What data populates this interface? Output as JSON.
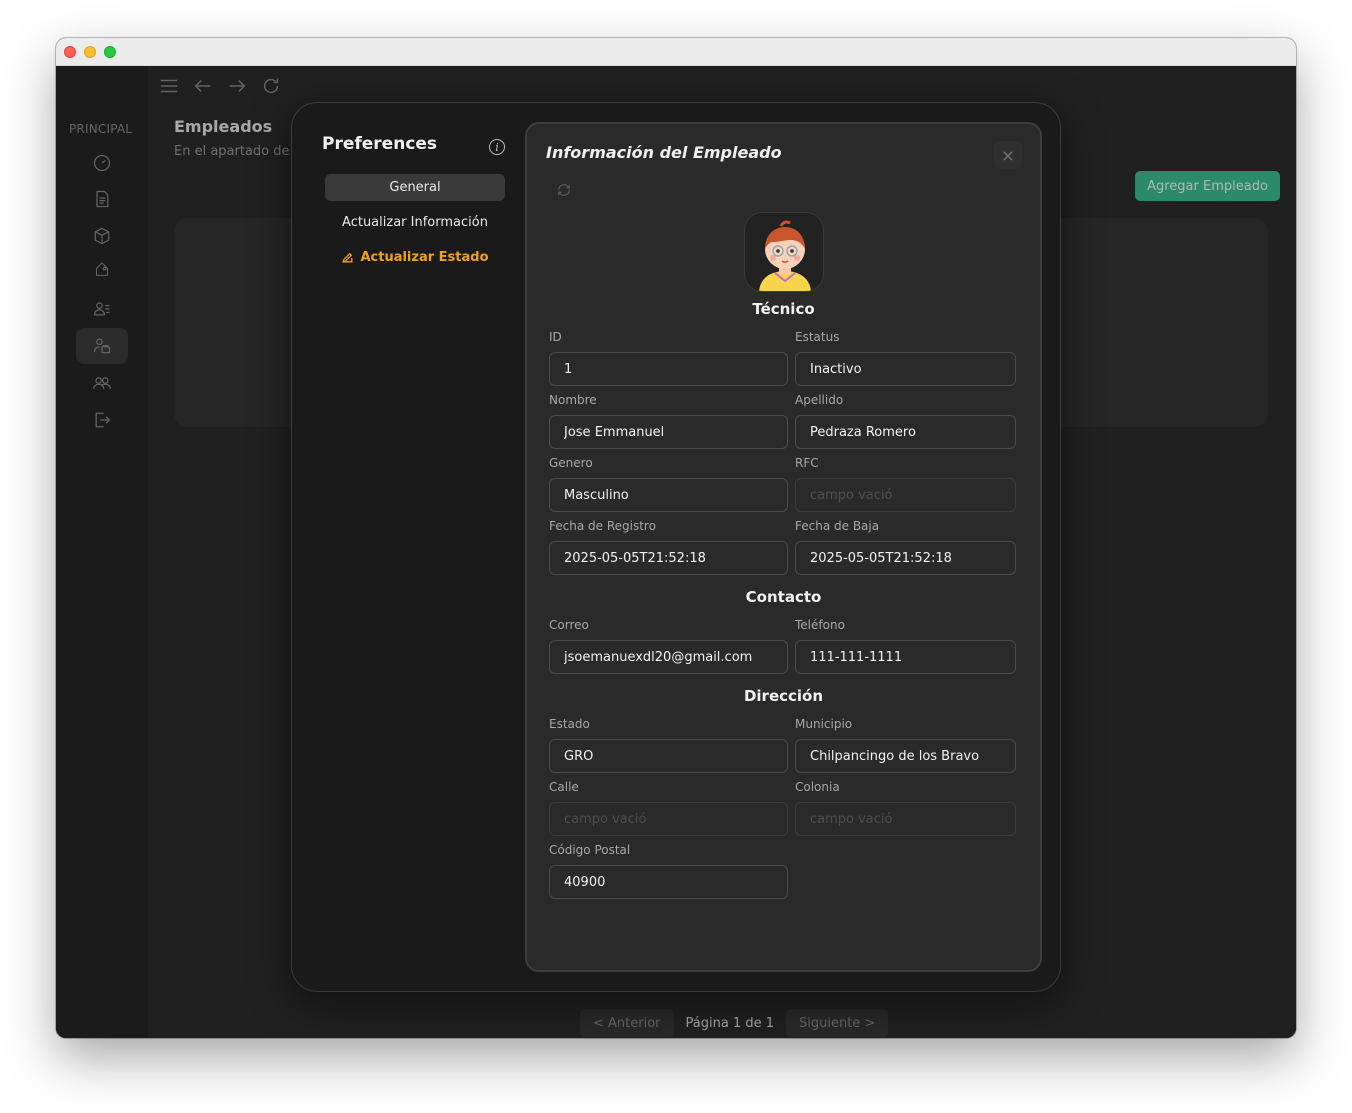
{
  "sidebar": {
    "section_label": "PRINCIPAL",
    "icons": [
      "dashboard-icon",
      "document-icon",
      "box-icon",
      "tag-icon",
      "user-list-icon",
      "employee-icon",
      "users-icon",
      "logout-icon"
    ]
  },
  "main": {
    "title": "Empleados",
    "subtitle": "En el apartado de l",
    "add_button": "Agregar Empleado",
    "pager": {
      "prev": "< Anterior",
      "page": "Página 1 de 1",
      "next": "Siguiente >"
    }
  },
  "preferences": {
    "title": "Preferences",
    "items": [
      {
        "label": "General"
      },
      {
        "label": "Actualizar Información"
      },
      {
        "label": "Actualizar Estado"
      }
    ]
  },
  "employee": {
    "title": "Información del Empleado",
    "close": "×",
    "role": "Técnico",
    "placeholder": "campo vació",
    "labels": {
      "id": "ID",
      "estatus": "Estatus",
      "nombre": "Nombre",
      "apellido": "Apellido",
      "genero": "Genero",
      "rfc": "RFC",
      "fecha_registro": "Fecha de Registro",
      "fecha_baja": "Fecha de Baja",
      "correo": "Correo",
      "telefono": "Teléfono",
      "estado": "Estado",
      "municipio": "Municipio",
      "calle": "Calle",
      "colonia": "Colonia",
      "codigo_postal": "Código Postal"
    },
    "sections": {
      "contacto": "Contacto",
      "direccion": "Dirección"
    },
    "values": {
      "id": "1",
      "estatus": "Inactivo",
      "nombre": "Jose Emmanuel",
      "apellido": "Pedraza Romero",
      "genero": "Masculino",
      "rfc": "",
      "fecha_registro": "2025-05-05T21:52:18",
      "fecha_baja": "2025-05-05T21:52:18",
      "correo": "jsoemanuexdl20@gmail.com",
      "telefono": "111-111-1111",
      "estado": "GRO",
      "municipio": "Chilpancingo de los Bravo",
      "calle": "",
      "colonia": "",
      "codigo_postal": "40900"
    }
  },
  "colors": {
    "accent": "#3bbf93",
    "warning": "#f0a21b",
    "modal_bg": "#1a1a1a",
    "panel_bg": "#2a2a2a"
  }
}
